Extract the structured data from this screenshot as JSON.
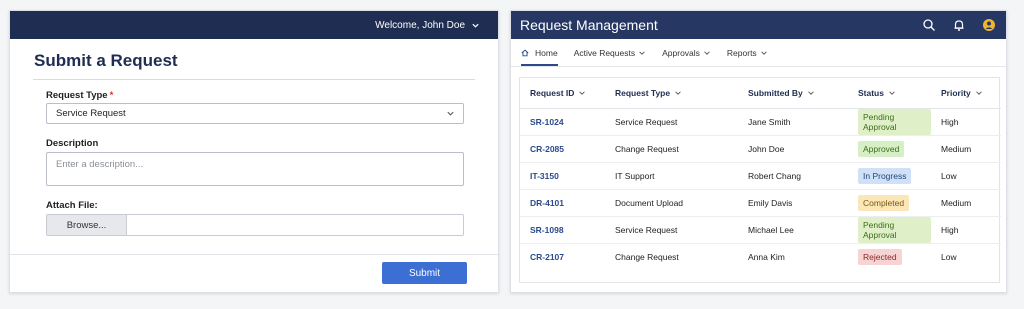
{
  "form": {
    "welcome": "Welcome, John Doe",
    "title": "Submit a Request",
    "request_type_label": "Request Type",
    "required_mark": "*",
    "request_type_value": "Service Request",
    "description_label": "Description",
    "description_placeholder": "Enter a description...",
    "attach_label": "Attach File:",
    "browse_label": "Browse...",
    "submit_label": "Submit"
  },
  "app": {
    "title": "Request Management",
    "icons": [
      "search-icon",
      "bell-icon",
      "user-avatar-icon"
    ],
    "nav": [
      {
        "label": "Home",
        "icon": "home-icon",
        "active": true
      },
      {
        "label": "Active Requests",
        "dropdown": true
      },
      {
        "label": "Approvals",
        "dropdown": true
      },
      {
        "label": "Reports",
        "dropdown": true
      }
    ]
  },
  "table": {
    "columns": [
      "Request ID",
      "Submitted By",
      "Request Type",
      "Status",
      "Priority"
    ],
    "header_order": [
      "Request ID",
      "Request Type",
      "Submitted By",
      "Status",
      "Priority"
    ],
    "rows": [
      {
        "id": "SR-1024",
        "type": "Service Request",
        "by": "Jane Smith",
        "status": "Pending Approval",
        "priority": "High"
      },
      {
        "id": "CR-2085",
        "type": "Change Request",
        "by": "John Doe",
        "status": "Approved",
        "priority": "Medium"
      },
      {
        "id": "IT-3150",
        "type": "IT Support",
        "by": "Robert Chang",
        "status": "In Progress",
        "priority": "Low"
      },
      {
        "id": "DR-4101",
        "type": "Document Upload",
        "by": "Emily Davis",
        "status": "Completed",
        "priority": "Medium"
      },
      {
        "id": "SR-1098",
        "type": "Service Request",
        "by": "Michael Lee",
        "status": "Pending Approval",
        "priority": "High"
      },
      {
        "id": "CR-2107",
        "type": "Change Request",
        "by": "Anna Kim",
        "status": "Rejected",
        "priority": "Low"
      }
    ]
  },
  "status_colors": {
    "Pending Approval": {
      "bg": "#dff0c8",
      "fg": "#3f6b1e"
    },
    "Approved": {
      "bg": "#d6efc4",
      "fg": "#3f6b1e"
    },
    "In Progress": {
      "bg": "#cfe0f7",
      "fg": "#23457e"
    },
    "Completed": {
      "bg": "#fbe6b8",
      "fg": "#7a5a12"
    },
    "Rejected": {
      "bg": "#f7d3d3",
      "fg": "#8a2a2a"
    }
  },
  "colors": {
    "header_bg": "#1f2d52",
    "accent": "#3b6fd4"
  }
}
